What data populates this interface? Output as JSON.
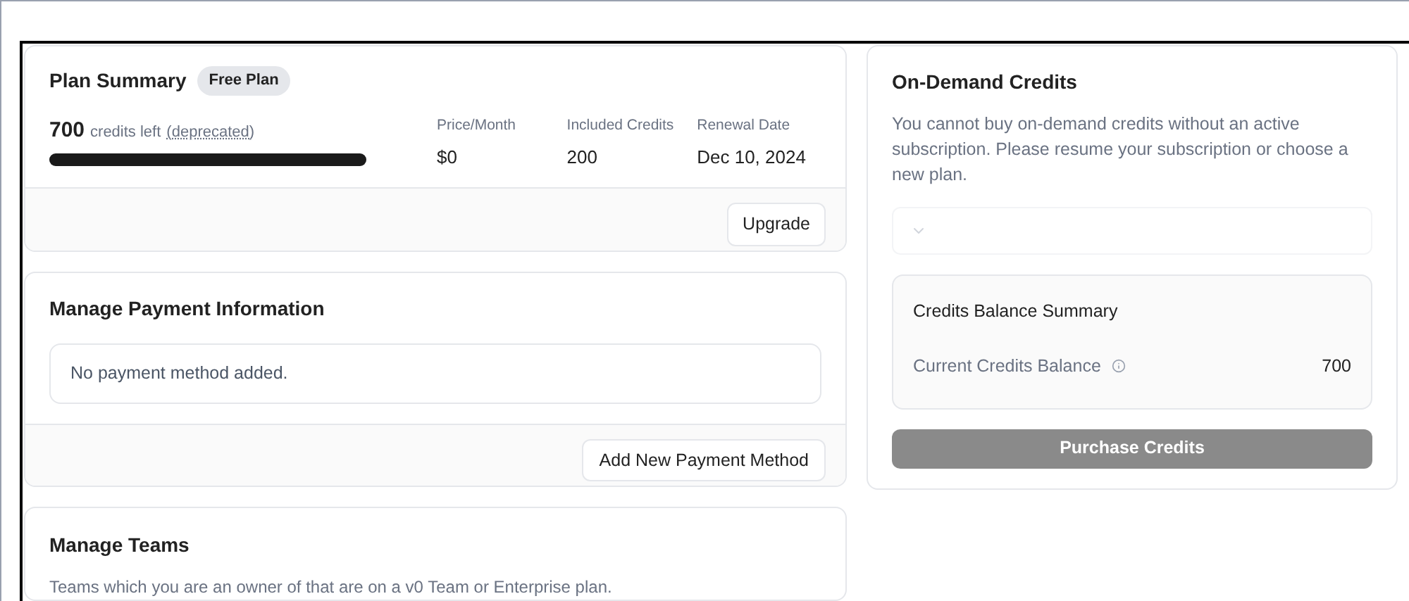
{
  "plan_summary": {
    "title": "Plan Summary",
    "badge": "Free Plan",
    "credits_count": "700",
    "credits_label": "credits left",
    "credits_link": "(deprecated)",
    "level": 1,
    "stats": [
      {
        "label": "Price/Month",
        "value": "$0"
      },
      {
        "label": "Included Credits",
        "value": "200"
      },
      {
        "label": "Renewal Date",
        "value": "Dec 10, 2024"
      }
    ],
    "button": "Upgrade"
  },
  "payment": {
    "title": "Manage Payment Information",
    "empty_message": "No payment method added.",
    "button": "Add New Payment Method"
  },
  "teams": {
    "title": "Manage Teams",
    "description": "Teams which you are an owner of that are on a v0 Team or Enterprise plan."
  },
  "on_demand": {
    "title": "On-Demand Credits",
    "description": "You cannot buy on-demand credits without an active subscription. Please resume your subscription or choose a new plan.",
    "select_disabled": true,
    "balance": {
      "title": "Credits Balance Summary",
      "label": "Current Credits Balance",
      "value": "700"
    },
    "button": "Purchase Credits",
    "button_disabled": true
  }
}
